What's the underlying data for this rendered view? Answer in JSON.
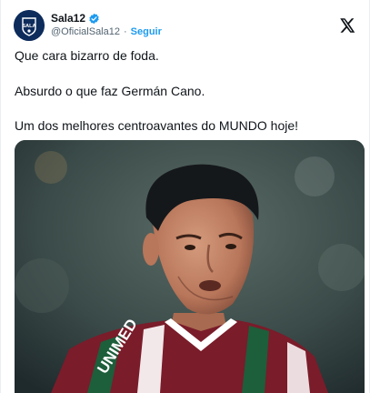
{
  "post": {
    "author_name": "Sala12",
    "author_handle": "@OficialSala12",
    "separator": "·",
    "follow_label": "Seguir",
    "avatar_text": "SALA",
    "paragraphs": [
      "Que cara bizarro de foda.",
      "Absurdo o que faz Germán Cano.",
      "Um dos melhores centroavantes do MUNDO hoje!"
    ],
    "jersey_text": "UNIMED"
  },
  "icons": {
    "verified": "verified-badge-icon",
    "platform": "x-logo-icon"
  },
  "colors": {
    "verified": "#1d9bf0",
    "follow": "#1d9bf0",
    "avatar_bg": "#0d2c5c",
    "text": "#0f1419",
    "muted": "#536471",
    "jersey_maroon": "#7a1c2a",
    "jersey_green": "#1d5e3b"
  }
}
